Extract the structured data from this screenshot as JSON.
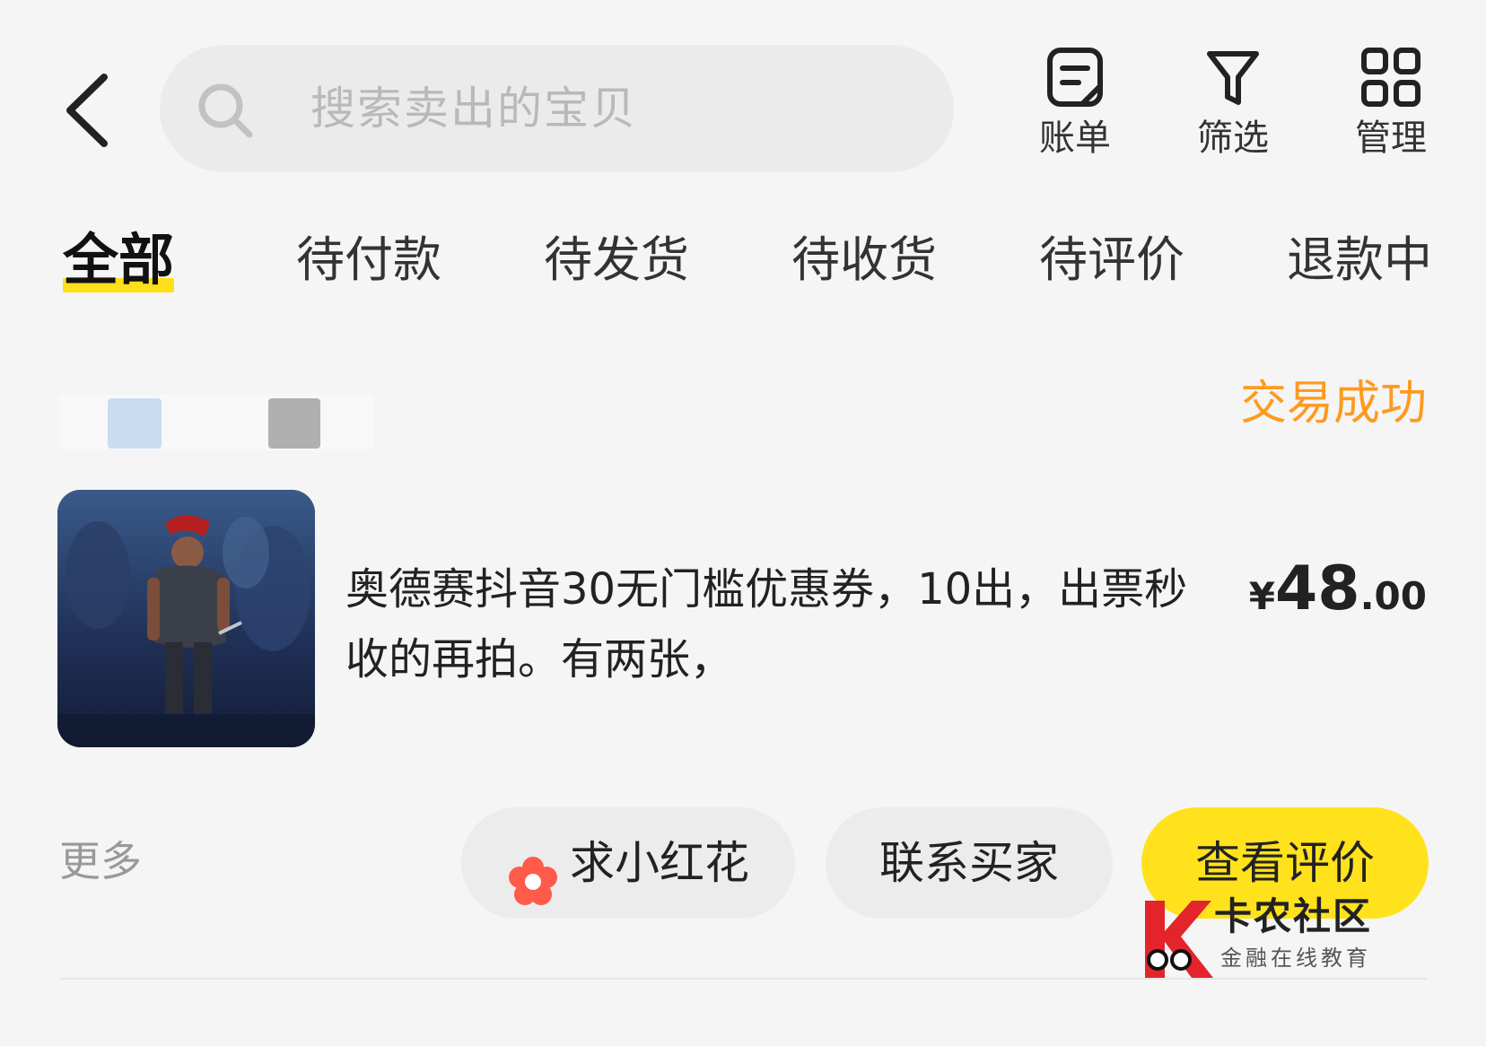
{
  "header": {
    "search_placeholder": "搜索卖出的宝贝",
    "tools": [
      {
        "icon": "bill-icon",
        "label": "账单"
      },
      {
        "icon": "filter-icon",
        "label": "筛选"
      },
      {
        "icon": "grid-icon",
        "label": "管理"
      }
    ]
  },
  "tabs": [
    {
      "label": "全部",
      "active": true
    },
    {
      "label": "待付款",
      "active": false
    },
    {
      "label": "待发货",
      "active": false
    },
    {
      "label": "待收货",
      "active": false
    },
    {
      "label": "待评价",
      "active": false
    },
    {
      "label": "退款中",
      "active": false
    }
  ],
  "order": {
    "status": "交易成功",
    "title": "奥德赛抖音30无门槛优惠券，10出，出票秒收的再拍。有两张，",
    "price": {
      "currency": "¥",
      "integer": "48",
      "decimal": ".00"
    },
    "more_label": "更多",
    "actions": {
      "flower": "求小红花",
      "contact": "联系买家",
      "review": "查看评价"
    }
  },
  "watermark": {
    "title": "卡农社区",
    "subtitle": "金融在线教育"
  },
  "colors": {
    "accent_yellow": "#ffe21c",
    "status_orange": "#ff9a1f",
    "background": "#f5f5f5"
  }
}
